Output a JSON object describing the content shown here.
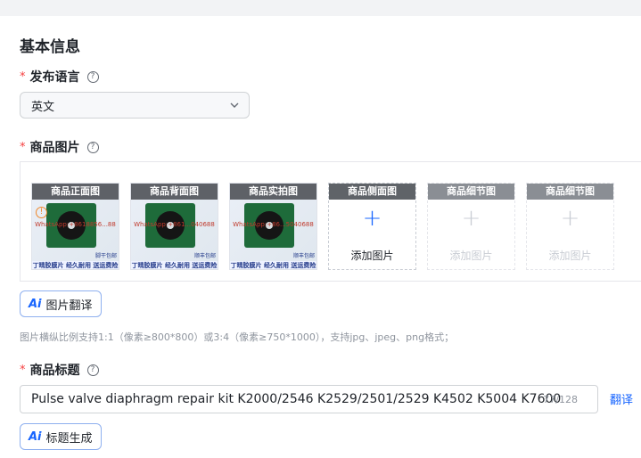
{
  "section": {
    "title": "基本信息"
  },
  "language": {
    "required_mark": "*",
    "label": "发布语言",
    "help": "?",
    "value": "英文"
  },
  "images": {
    "required_mark": "*",
    "label": "商品图片",
    "help": "?",
    "filled_slots": [
      {
        "caption": "商品正面图",
        "watermark": "WhatsApp:+8618856...88",
        "side_text": "脚干包邮",
        "photo_text": "丁晴胶膜片 经久耐用 送运费险",
        "warning": "!"
      },
      {
        "caption": "商品背面图",
        "watermark": "WhatsApp:+861...040688",
        "side_text": "顺丰包邮",
        "photo_text": "丁晴胶膜片 经久耐用 送运费险",
        "warning": ""
      },
      {
        "caption": "商品实拍图",
        "watermark": "WhatsApp:+86...5040688",
        "side_text": "顺丰包邮",
        "photo_text": "丁晴胶膜片 经久耐用 送运费险",
        "warning": ""
      }
    ],
    "empty_slots": [
      {
        "caption": "商品侧面图",
        "plus": "+",
        "add_label": "添加图片",
        "disabled": false
      },
      {
        "caption": "商品细节图",
        "plus": "+",
        "add_label": "添加图片",
        "disabled": true
      },
      {
        "caption": "商品细节图",
        "plus": "+",
        "add_label": "添加图片",
        "disabled": true
      }
    ],
    "translate_button": {
      "icon": "Ai",
      "label": "图片翻译"
    },
    "hint": "图片横纵比例支持1:1（像素≥800*800）或3:4（像素≥750*1000），支持jpg、jpeg、png格式；"
  },
  "product_title": {
    "required_mark": "*",
    "label": "商品标题",
    "help": "?",
    "value": "Pulse valve diaphragm repair kit K2000/2546 K2529/2501/2529 K4502 K5004 K7600",
    "count": "77/128",
    "translate_link": "翻译",
    "generate_button": {
      "icon": "Ai",
      "label": "标题生成"
    }
  },
  "colors": {
    "accent": "#1664ff",
    "required": "#f53f3f",
    "caption_bg": "#5f6368"
  }
}
